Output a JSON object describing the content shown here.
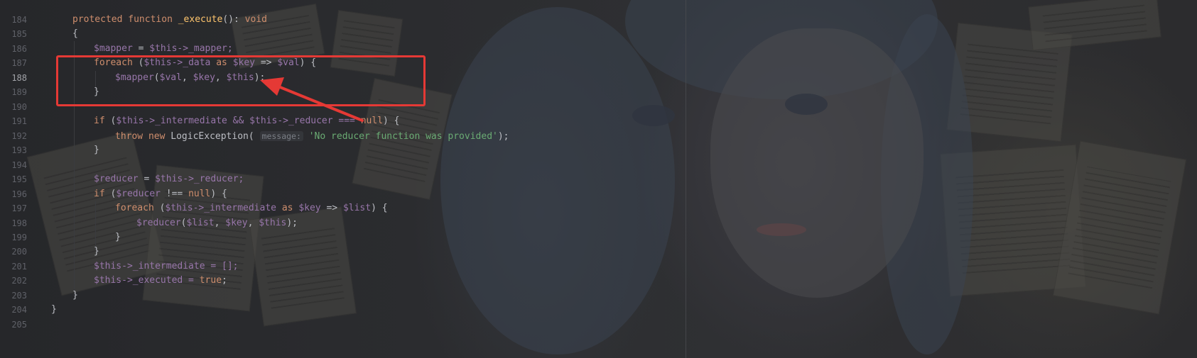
{
  "colors": {
    "background": "#1e1f22",
    "keyword": "#cf8e6d",
    "variable": "#9876aa",
    "method": "#ffc66d",
    "string": "#6aab73",
    "annotation": "#e53935"
  },
  "gutter": {
    "current_line": "188",
    "lines": [
      "184",
      "185",
      "186",
      "187",
      "188",
      "189",
      "190",
      "191",
      "192",
      "193",
      "194",
      "195",
      "196",
      "197",
      "198",
      "199",
      "200",
      "201",
      "202",
      "203",
      "204",
      "205"
    ]
  },
  "code": {
    "l184": {
      "kw1": "protected",
      "kw2": "function",
      "name": "_execute",
      "rest": "(): ",
      "type": "void"
    },
    "l185": {
      "text": "{"
    },
    "l186": {
      "v1": "$mapper",
      "op": " = ",
      "v2": "$this",
      "prop": "->_mapper;"
    },
    "l187": {
      "kw": "foreach",
      "p1": " (",
      "v1": "$this",
      "prop": "->_data ",
      "as": "as",
      "sp": " ",
      "v2": "$key",
      "arrow": " => ",
      "v3": "$val",
      "end": ") {"
    },
    "l188": {
      "v1": "$mapper",
      "p1": "(",
      "v2": "$val",
      "c1": ", ",
      "v3": "$key",
      "c2": ", ",
      "v4": "$this",
      "end": ");"
    },
    "l189": {
      "text": "}"
    },
    "l191": {
      "kw": "if",
      "p1": " (",
      "v1": "$this",
      "prop1": "->_intermediate && ",
      "v2": "$this",
      "prop2": "->_reducer === ",
      "null": "null",
      "end": ") {"
    },
    "l192": {
      "kw1": "throw",
      "kw2": "new",
      "cls": "LogicException(",
      "hint": "message:",
      "str": "'No reducer function was provided'",
      "end": ");"
    },
    "l193": {
      "text": "}"
    },
    "l195": {
      "v1": "$reducer",
      "op": " = ",
      "v2": "$this",
      "prop": "->_reducer;"
    },
    "l196": {
      "kw": "if",
      "p1": " (",
      "v1": "$reducer",
      "op": " !== ",
      "null": "null",
      "end": ") {"
    },
    "l197": {
      "kw": "foreach",
      "p1": " (",
      "v1": "$this",
      "prop": "->_intermediate ",
      "as": "as",
      "sp": " ",
      "v2": "$key",
      "arrow": " => ",
      "v3": "$list",
      "end": ") {"
    },
    "l198": {
      "v1": "$reducer",
      "p1": "(",
      "v2": "$list",
      "c1": ", ",
      "v3": "$key",
      "c2": ", ",
      "v4": "$this",
      "end": ");"
    },
    "l199": {
      "text": "}"
    },
    "l200": {
      "text": "}"
    },
    "l201": {
      "v1": "$this",
      "prop": "->_intermediate = [];"
    },
    "l202": {
      "v1": "$this",
      "prop": "->_executed = ",
      "val": "true",
      "end": ";"
    },
    "l203": {
      "text": "}"
    },
    "l204": {
      "text": "}"
    }
  }
}
